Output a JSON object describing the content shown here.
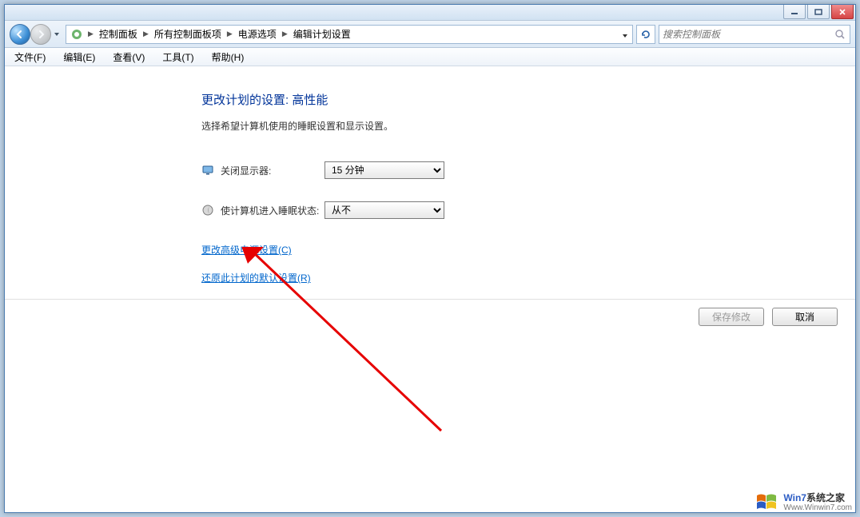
{
  "window_controls": {
    "min_title": "最小化",
    "max_title": "最大化",
    "close_title": "关闭"
  },
  "breadcrumb": {
    "items": [
      "控制面板",
      "所有控制面板项",
      "电源选项",
      "编辑计划设置"
    ]
  },
  "refresh_title": "刷新",
  "search": {
    "placeholder": "搜索控制面板"
  },
  "menu": {
    "file": "文件(F)",
    "edit": "编辑(E)",
    "view": "查看(V)",
    "tools": "工具(T)",
    "help": "帮助(H)"
  },
  "page": {
    "title": "更改计划的设置: 高性能",
    "subtitle": "选择希望计算机使用的睡眠设置和显示设置。",
    "settings": {
      "display_off": {
        "label": "关闭显示器:",
        "value": "15 分钟"
      },
      "sleep": {
        "label": "使计算机进入睡眠状态:",
        "value": "从不"
      }
    },
    "links": {
      "advanced": "更改高级电源设置(C)",
      "restore": "还原此计划的默认设置(R)"
    },
    "buttons": {
      "save": "保存修改",
      "cancel": "取消"
    }
  },
  "watermark": {
    "line1_brand": "Win7",
    "line1_rest": "系统之家",
    "line2": "Www.Winwin7.com"
  }
}
